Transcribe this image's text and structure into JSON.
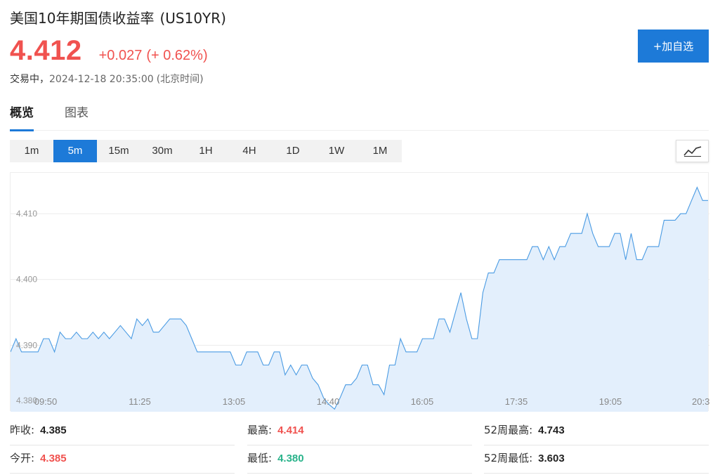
{
  "header": {
    "title": "美国10年期国债收益率",
    "code": "(US10YR)",
    "price": "4.412",
    "change": "+0.027",
    "change_pct": "(+ 0.62%)",
    "status": "交易中，",
    "timestamp": "2024-12-18 20:35:00",
    "timezone": "(北京时间)",
    "add_button": "+加自选"
  },
  "tabs": [
    {
      "label": "概览",
      "active": true
    },
    {
      "label": "图表",
      "active": false
    }
  ],
  "periods": [
    {
      "label": "1m",
      "active": false
    },
    {
      "label": "5m",
      "active": true
    },
    {
      "label": "15m",
      "active": false
    },
    {
      "label": "30m",
      "active": false
    },
    {
      "label": "1H",
      "active": false
    },
    {
      "label": "4H",
      "active": false
    },
    {
      "label": "1D",
      "active": false
    },
    {
      "label": "1W",
      "active": false
    },
    {
      "label": "1M",
      "active": false
    }
  ],
  "chart_type_icon": "line-chart-icon",
  "colors": {
    "up": "#f0524f",
    "down": "#2ab38b",
    "accent": "#1d7ad8",
    "line": "#4a9be3",
    "area": "#e3effc"
  },
  "stats": {
    "prev_close_label": "昨收:",
    "prev_close": "4.385",
    "high_label": "最高:",
    "high": "4.414",
    "week52_high_label": "52周最高:",
    "week52_high": "4.743",
    "open_label": "今开:",
    "open": "4.385",
    "low_label": "最低:",
    "low": "4.380",
    "week52_low_label": "52周最低:",
    "week52_low": "3.603"
  },
  "chart_data": {
    "type": "area",
    "x_tick_labels": [
      "09:50",
      "11:25",
      "13:05",
      "14:40",
      "16:05",
      "17:35",
      "19:05",
      "20:3"
    ],
    "y_tick_labels": [
      "4.410",
      "4.400",
      "4.390",
      "4.380"
    ],
    "ylim": [
      4.3799,
      4.4162
    ],
    "grid": true,
    "series": [
      {
        "values": [
          4.389,
          4.391,
          4.389,
          4.389,
          4.389,
          4.389,
          4.391,
          4.391,
          4.389,
          4.392,
          4.391,
          4.391,
          4.392,
          4.391,
          4.391,
          4.392,
          4.391,
          4.392,
          4.391,
          4.392,
          4.393,
          4.392,
          4.391,
          4.394,
          4.393,
          4.394,
          4.392,
          4.392,
          4.393,
          4.394,
          4.394,
          4.394,
          4.393,
          4.391,
          4.389,
          4.389,
          4.389,
          4.389,
          4.389,
          4.389,
          4.389,
          4.387,
          4.387,
          4.389,
          4.389,
          4.389,
          4.387,
          4.387,
          4.389,
          4.389,
          4.3855,
          4.387,
          4.3855,
          4.387,
          4.387,
          4.385,
          4.384,
          4.382,
          4.381,
          4.3803,
          4.382,
          4.384,
          4.384,
          4.385,
          4.387,
          4.387,
          4.384,
          4.384,
          4.3825,
          4.387,
          4.387,
          4.391,
          4.389,
          4.389,
          4.389,
          4.391,
          4.391,
          4.391,
          4.394,
          4.394,
          4.392,
          4.395,
          4.398,
          4.394,
          4.391,
          4.391,
          4.398,
          4.401,
          4.401,
          4.403,
          4.403,
          4.403,
          4.403,
          4.403,
          4.403,
          4.405,
          4.405,
          4.403,
          4.405,
          4.403,
          4.405,
          4.405,
          4.407,
          4.407,
          4.407,
          4.41,
          4.407,
          4.405,
          4.405,
          4.405,
          4.407,
          4.407,
          4.403,
          4.407,
          4.403,
          4.403,
          4.405,
          4.405,
          4.405,
          4.409,
          4.409,
          4.409,
          4.41,
          4.41,
          4.412,
          4.414,
          4.412,
          4.412
        ]
      }
    ]
  }
}
